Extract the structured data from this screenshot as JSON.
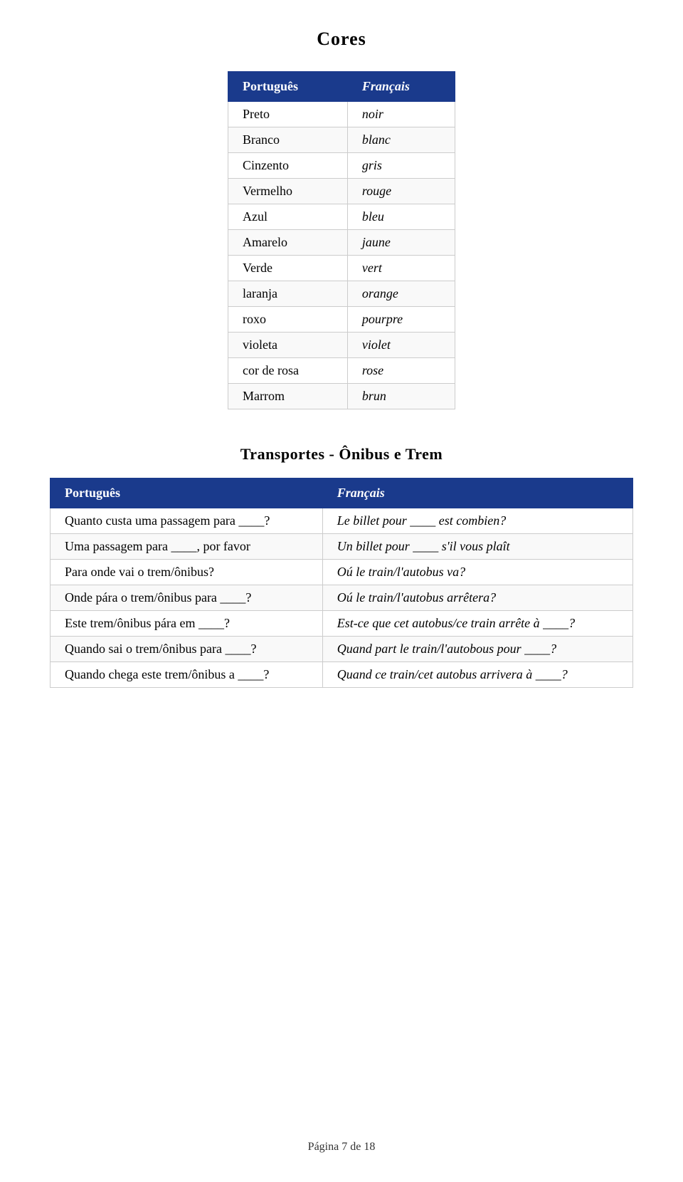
{
  "page": {
    "title": "Cores",
    "section2_title": "Transportes - Ônibus e Trem",
    "footer": "Página 7 de 18"
  },
  "colors_table": {
    "headers": [
      "Português",
      "Français"
    ],
    "rows": [
      [
        "Preto",
        "noir"
      ],
      [
        "Branco",
        "blanc"
      ],
      [
        "Cinzento",
        "gris"
      ],
      [
        "Vermelho",
        "rouge"
      ],
      [
        "Azul",
        "bleu"
      ],
      [
        "Amarelo",
        "jaune"
      ],
      [
        "Verde",
        "vert"
      ],
      [
        "laranja",
        "orange"
      ],
      [
        "roxo",
        "pourpre"
      ],
      [
        "violeta",
        "violet"
      ],
      [
        "cor de rosa",
        "rose"
      ],
      [
        "Marrom",
        "brun"
      ]
    ]
  },
  "transport_table": {
    "headers": [
      "Português",
      "Français"
    ],
    "rows": [
      [
        "Quanto custa uma passagem para ____?",
        "Le billet pour ____ est combien?"
      ],
      [
        "Uma passagem para ____, por favor",
        "Un billet pour ____ s'il vous plaît"
      ],
      [
        "Para onde vai o trem/ônibus?",
        "Oú le train/l'autobus va?"
      ],
      [
        "Onde pára o trem/ônibus para ____?",
        "Oú le train/l'autobus arrêtera?"
      ],
      [
        "Este trem/ônibus pára em ____?",
        "Est-ce que cet autobus/ce train arrête à ____?"
      ],
      [
        "Quando sai o trem/ônibus para ____?",
        "Quand part le train/l'autobous pour ____?"
      ],
      [
        "Quando chega este trem/ônibus a ____?",
        "Quand ce train/cet autobus arrivera à ____?"
      ]
    ]
  }
}
